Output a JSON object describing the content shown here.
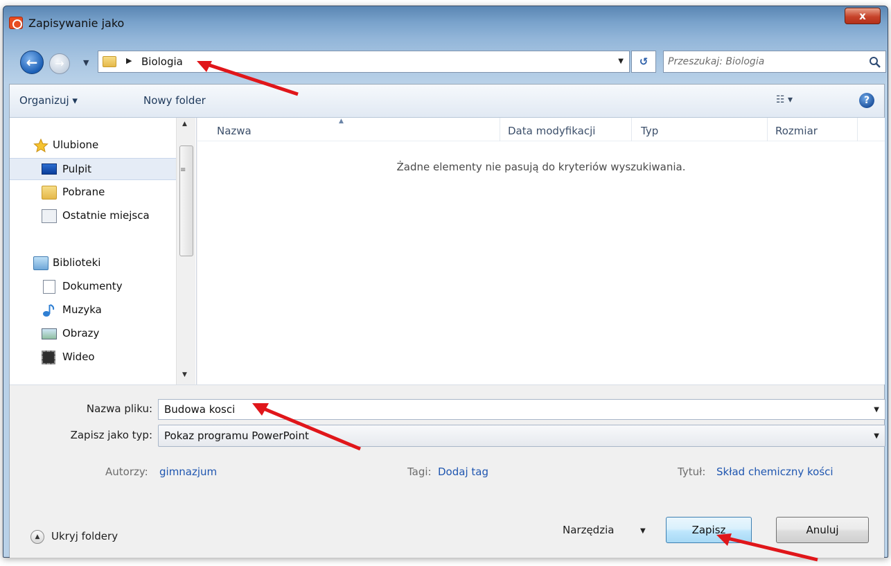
{
  "window": {
    "title": "Zapisywanie jako",
    "close_label": "x"
  },
  "navigation": {
    "breadcrumb": [
      "Biologia"
    ],
    "search_placeholder": "Przeszukaj: Biologia"
  },
  "toolbar": {
    "organize_label": "Organizuj ▾",
    "new_folder_label": "Nowy folder"
  },
  "nav_pane": {
    "favorites_header": "Ulubione",
    "favorites": [
      "Pulpit",
      "Pobrane",
      "Ostatnie miejsca"
    ],
    "libraries_header": "Biblioteki",
    "libraries": [
      "Dokumenty",
      "Muzyka",
      "Obrazy",
      "Wideo"
    ]
  },
  "file_list": {
    "columns": [
      "Nazwa",
      "Data modyfikacji",
      "Typ",
      "Rozmiar"
    ],
    "empty_message": "Żadne elementy nie pasują do kryteriów wyszukiwania."
  },
  "form": {
    "filename_label": "Nazwa pliku:",
    "filename_value": "Budowa kosci",
    "filetype_label": "Zapisz jako typ:",
    "filetype_value": "Pokaz programu PowerPoint",
    "authors_label": "Autorzy:",
    "authors_value": "gimnazjum",
    "tags_label": "Tagi:",
    "tags_value": "Dodaj tag",
    "title_label": "Tytuł:",
    "title_value": "Skład chemiczny kości"
  },
  "footer": {
    "hide_folders_label": "Ukryj foldery",
    "tools_label": "Narzędzia",
    "save_label": "Zapisz",
    "cancel_label": "Anuluj"
  },
  "colors": {
    "annotation_arrow": "#e0161a",
    "link": "#1f56b0",
    "accent": "#3c7fb1"
  }
}
